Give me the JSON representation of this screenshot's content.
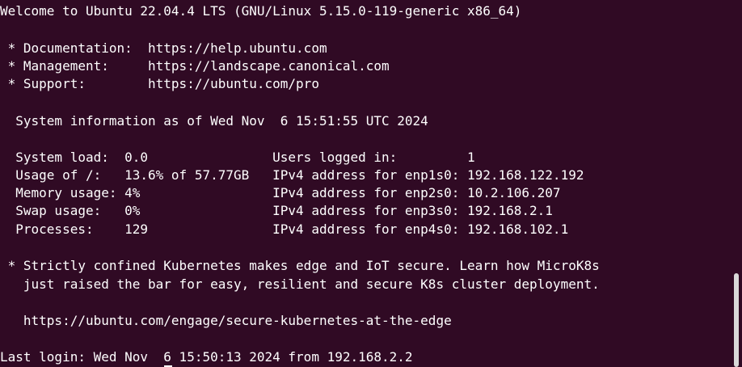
{
  "terminal": {
    "lines": [
      "Welcome to Ubuntu 22.04.4 LTS (GNU/Linux 5.15.0-119-generic x86_64)",
      "",
      " * Documentation:  https://help.ubuntu.com",
      " * Management:     https://landscape.canonical.com",
      " * Support:        https://ubuntu.com/pro",
      "",
      "  System information as of Wed Nov  6 15:51:55 UTC 2024",
      "",
      "  System load:  0.0                Users logged in:         1",
      "  Usage of /:   13.6% of 57.77GB   IPv4 address for enp1s0: 192.168.122.192",
      "  Memory usage: 4%                 IPv4 address for enp2s0: 10.2.106.207",
      "  Swap usage:   0%                 IPv4 address for enp3s0: 192.168.2.1",
      "  Processes:    129                IPv4 address for enp4s0: 192.168.102.1",
      "",
      " * Strictly confined Kubernetes makes edge and IoT secure. Learn how MicroK8s",
      "   just raised the bar for easy, resilient and secure K8s cluster deployment.",
      "",
      "   https://ubuntu.com/engage/secure-kubernetes-at-the-edge",
      "",
      "Last login: Wed Nov  6 15:50:13 2024 from 192.168.2.2"
    ]
  },
  "colors": {
    "background": "#300a24",
    "foreground": "#ffffff",
    "scrollbar": "#d9d9d9"
  }
}
